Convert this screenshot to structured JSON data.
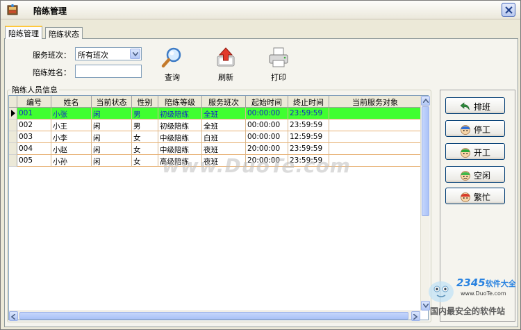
{
  "window": {
    "title": "陪练管理"
  },
  "tabs": [
    {
      "label": "陪练管理",
      "active": true
    },
    {
      "label": "陪练状态",
      "active": false
    }
  ],
  "filters": {
    "shift_label": "服务班次：",
    "shift_value": "所有班次",
    "name_label": "陪练姓名：",
    "name_value": ""
  },
  "toolbar": {
    "query_label": "查询",
    "refresh_label": "刷新",
    "print_label": "打印"
  },
  "group": {
    "title": "陪练人员信息"
  },
  "table": {
    "columns": [
      "编号",
      "姓名",
      "当前状态",
      "性别",
      "陪练等级",
      "服务班次",
      "起始时间",
      "终止时间",
      "当前服务对象"
    ],
    "rows": [
      [
        "001",
        "小张",
        "闲",
        "男",
        "初级陪练",
        "全班",
        "00:00:00",
        "23:59:59",
        ""
      ],
      [
        "002",
        "小王",
        "闲",
        "男",
        "初级陪练",
        "全班",
        "00:00:00",
        "23:59:59",
        ""
      ],
      [
        "003",
        "小李",
        "闲",
        "女",
        "中级陪练",
        "白班",
        "00:00:00",
        "12:59:59",
        ""
      ],
      [
        "004",
        "小赵",
        "闲",
        "女",
        "中级陪练",
        "夜班",
        "20:00:00",
        "23:59:59",
        ""
      ],
      [
        "005",
        "小孙",
        "闲",
        "女",
        "高级陪练",
        "夜班",
        "20:00:00",
        "23:59:59",
        ""
      ]
    ],
    "selected_row": 0
  },
  "actions": {
    "schedule_label": "排班",
    "stop_label": "停工",
    "start_label": "开工",
    "idle_label": "空闲",
    "busy_label": "繁忙"
  },
  "watermark": {
    "text": "www.DuoTe.com",
    "logo_number": "2345",
    "logo_suffix": "软件大全",
    "logo_url": "www.DuoTe.com",
    "logo_slogan": "国内最安全的软件站"
  },
  "colors": {
    "selected_row_bg": "#40ff30",
    "selected_row_text": "#1525c8",
    "row_border": "#e7b073",
    "window_bg": "#ece9d8"
  }
}
